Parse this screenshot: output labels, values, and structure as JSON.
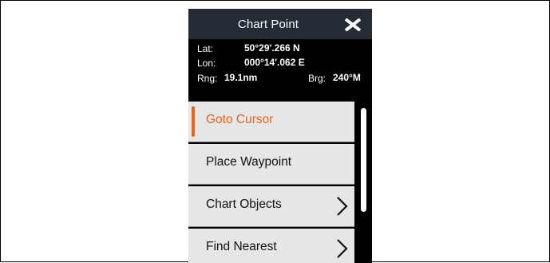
{
  "header": {
    "title": "Chart Point",
    "close_icon": "close-x-icon"
  },
  "position": {
    "lat_label": "Lat:",
    "lat_value": "50°29'.266 N",
    "lon_label": "Lon:",
    "lon_value": "000°14'.062 E",
    "rng_label": "Rng:",
    "rng_value": "19.1nm",
    "brg_label": "Brg:",
    "brg_value": "240°M"
  },
  "menu": {
    "items": [
      {
        "label": "Goto Cursor",
        "active": true,
        "has_submenu": false
      },
      {
        "label": "Place Waypoint",
        "active": false,
        "has_submenu": false
      },
      {
        "label": "Chart Objects",
        "active": false,
        "has_submenu": true
      },
      {
        "label": "Find Nearest",
        "active": false,
        "has_submenu": true
      }
    ]
  },
  "colors": {
    "accent": "#e8641b",
    "header_bg": "#252c36",
    "item_bg": "#e6e6e6"
  }
}
